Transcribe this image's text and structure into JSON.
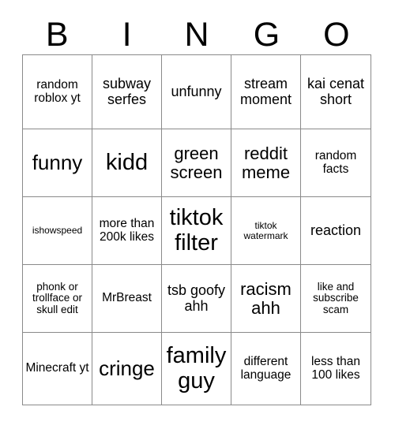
{
  "header": {
    "letters": [
      "B",
      "I",
      "N",
      "G",
      "O"
    ]
  },
  "grid": {
    "rows": 5,
    "columns": 5,
    "cells": [
      {
        "text": "random roblox yt",
        "size": "fs-m"
      },
      {
        "text": "subway serfes",
        "size": "fs-l"
      },
      {
        "text": "unfunny",
        "size": "fs-l"
      },
      {
        "text": "stream moment",
        "size": "fs-l"
      },
      {
        "text": "kai cenat short",
        "size": "fs-l"
      },
      {
        "text": "funny",
        "size": "fs-xxl"
      },
      {
        "text": "kidd",
        "size": "fs-xxxl"
      },
      {
        "text": "green screen",
        "size": "fs-xl"
      },
      {
        "text": "reddit meme",
        "size": "fs-xl"
      },
      {
        "text": "random facts",
        "size": "fs-m"
      },
      {
        "text": "ishowspeed",
        "size": "fs-xs"
      },
      {
        "text": "more than 200k likes",
        "size": "fs-m"
      },
      {
        "text": "tiktok filter",
        "size": "fs-xxxl"
      },
      {
        "text": "tiktok watermark",
        "size": "fs-xs"
      },
      {
        "text": "reaction",
        "size": "fs-l"
      },
      {
        "text": "phonk or trollface or skull edit",
        "size": "fs-s"
      },
      {
        "text": "MrBreast",
        "size": "fs-m"
      },
      {
        "text": "tsb goofy ahh",
        "size": "fs-l"
      },
      {
        "text": "racism ahh",
        "size": "fs-xl"
      },
      {
        "text": "like and subscribe scam",
        "size": "fs-s"
      },
      {
        "text": "Minecraft yt",
        "size": "fs-m"
      },
      {
        "text": "cringe",
        "size": "fs-xxl"
      },
      {
        "text": "family guy",
        "size": "fs-xxxl"
      },
      {
        "text": "different language",
        "size": "fs-m"
      },
      {
        "text": "less than 100 likes",
        "size": "fs-m"
      }
    ]
  },
  "colors": {
    "border": "#8a8a8a",
    "text": "#000000",
    "background": "#ffffff"
  }
}
